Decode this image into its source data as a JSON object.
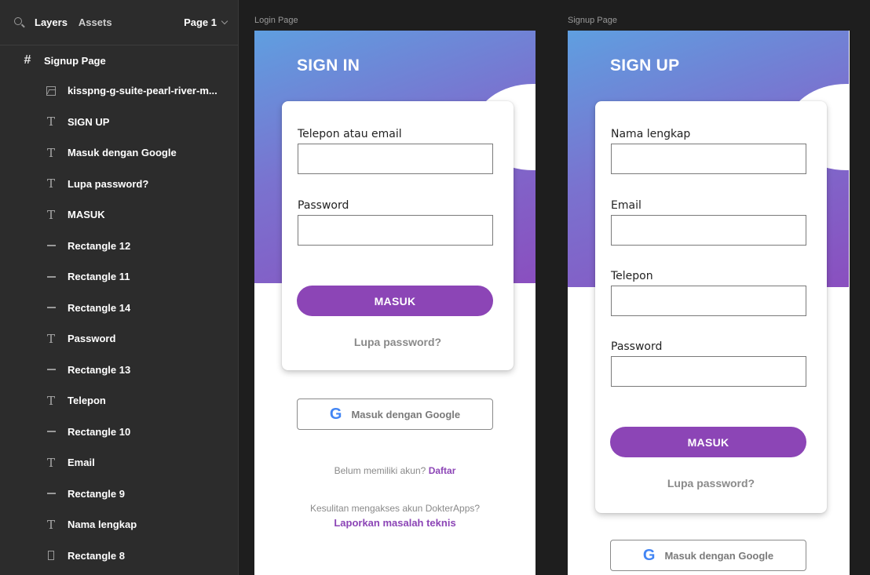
{
  "sidebar": {
    "tab_layers": "Layers",
    "tab_assets": "Assets",
    "page_selector": "Page 1",
    "layers": [
      {
        "label": "Signup Page",
        "icon": "frame-icon"
      },
      {
        "label": "kisspng-g-suite-pearl-river-m...",
        "icon": "image-icon"
      },
      {
        "label": "SIGN UP",
        "icon": "text-icon"
      },
      {
        "label": "Masuk dengan Google",
        "icon": "text-icon"
      },
      {
        "label": "Lupa password?",
        "icon": "text-icon"
      },
      {
        "label": "MASUK",
        "icon": "text-icon"
      },
      {
        "label": "Rectangle 12",
        "icon": "rectangle-icon"
      },
      {
        "label": "Rectangle 11",
        "icon": "rectangle-icon"
      },
      {
        "label": "Rectangle 14",
        "icon": "rectangle-icon"
      },
      {
        "label": "Password",
        "icon": "text-icon"
      },
      {
        "label": "Rectangle 13",
        "icon": "rectangle-icon"
      },
      {
        "label": "Telepon",
        "icon": "text-icon"
      },
      {
        "label": "Rectangle 10",
        "icon": "rectangle-icon"
      },
      {
        "label": "Email",
        "icon": "text-icon"
      },
      {
        "label": "Rectangle 9",
        "icon": "rectangle-icon"
      },
      {
        "label": "Nama lengkap",
        "icon": "text-icon"
      },
      {
        "label": "Rectangle 8",
        "icon": "rectangle-tall-icon"
      }
    ]
  },
  "login": {
    "frame_label": "Login Page",
    "title": "SIGN IN",
    "phone_label": "Telepon atau email",
    "password_label": "Password",
    "submit": "MASUK",
    "forgot": "Lupa password?",
    "google_glyph": "G",
    "google": "Masuk dengan Google",
    "no_account": "Belum memiliki akun?",
    "register": "Daftar",
    "trouble": "Kesulitan mengakses akun DokterApps?",
    "report": "Laporkan masalah teknis"
  },
  "signup": {
    "frame_label": "Signup Page",
    "title": "SIGN UP",
    "name_label": "Nama lengkap",
    "email_label": "Email",
    "phone_label": "Telepon",
    "password_label": "Password",
    "submit": "MASUK",
    "forgot": "Lupa password?",
    "google_glyph": "G",
    "google": "Masuk dengan Google"
  },
  "colors": {
    "primary": "#8c45b6",
    "gradient_start": "#5f9fe0",
    "gradient_end": "#8a4fbf",
    "sidebar_bg": "#2c2c2c",
    "canvas_bg": "#1e1e1e"
  }
}
